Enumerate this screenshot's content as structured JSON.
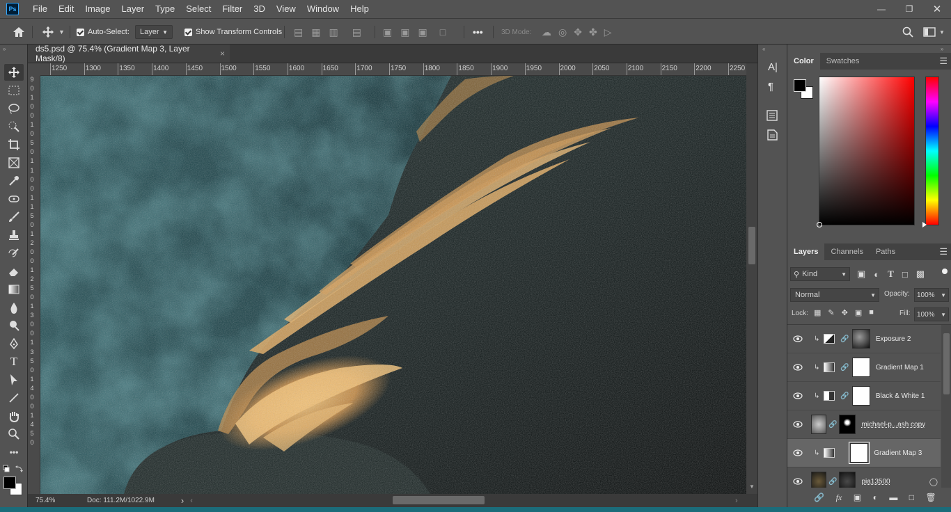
{
  "menubar": {
    "logo": "Ps",
    "items": [
      "File",
      "Edit",
      "Image",
      "Layer",
      "Type",
      "Select",
      "Filter",
      "3D",
      "View",
      "Window",
      "Help"
    ],
    "window_controls": [
      "minimize-icon",
      "restore-icon",
      "close-icon"
    ]
  },
  "options": {
    "auto_select_label": "Auto-Select:",
    "auto_select_value": "Layer",
    "show_transform_label": "Show Transform Controls",
    "mode3d_label": "3D Mode:",
    "more": "•••"
  },
  "document": {
    "tab_title": "ds5.psd @ 75.4% (Gradient Map 3, Layer Mask/8)",
    "close": "×"
  },
  "rulers": {
    "top_ticks": [
      "1250",
      "1300",
      "1350",
      "1400",
      "1450",
      "1500",
      "1550",
      "1600",
      "1650",
      "1700",
      "1750",
      "1800",
      "1850",
      "1900",
      "1950",
      "2000",
      "2050",
      "2100",
      "2150",
      "2200",
      "2250"
    ],
    "left_ticks": [
      "9",
      "0",
      "1",
      "0",
      "0",
      "1",
      "0",
      "5",
      "0",
      "1",
      "1",
      "0",
      "0",
      "1",
      "1",
      "5",
      "0",
      "1",
      "2",
      "0",
      "0",
      "1",
      "2",
      "5",
      "0",
      "1",
      "3",
      "0",
      "0",
      "1",
      "3",
      "5",
      "0",
      "1",
      "4",
      "0",
      "0",
      "1",
      "4",
      "5",
      "0"
    ]
  },
  "status": {
    "zoom": "75.4%",
    "doc": "Doc: 111.2M/1022.9M",
    "arrow": "›"
  },
  "color_panel": {
    "tabs": [
      "Color",
      "Swatches"
    ],
    "foreground": "#000000",
    "background": "#ffffff",
    "hue_color": "#ff0000"
  },
  "layers_panel": {
    "tabs": [
      "Layers",
      "Channels",
      "Paths"
    ],
    "filter_kind": "Kind",
    "blend_mode": "Normal",
    "opacity_label": "Opacity:",
    "opacity_value": "100%",
    "lock_label": "Lock:",
    "fill_label": "Fill:",
    "fill_value": "100%",
    "layers": [
      {
        "name": "Exposure 2"
      },
      {
        "name": "Gradient Map 1"
      },
      {
        "name": "Black & White 1"
      },
      {
        "name": "michael-p...ash copy"
      },
      {
        "name": "Gradient Map 3"
      },
      {
        "name": "pia13500"
      }
    ],
    "selected_index": 4
  }
}
